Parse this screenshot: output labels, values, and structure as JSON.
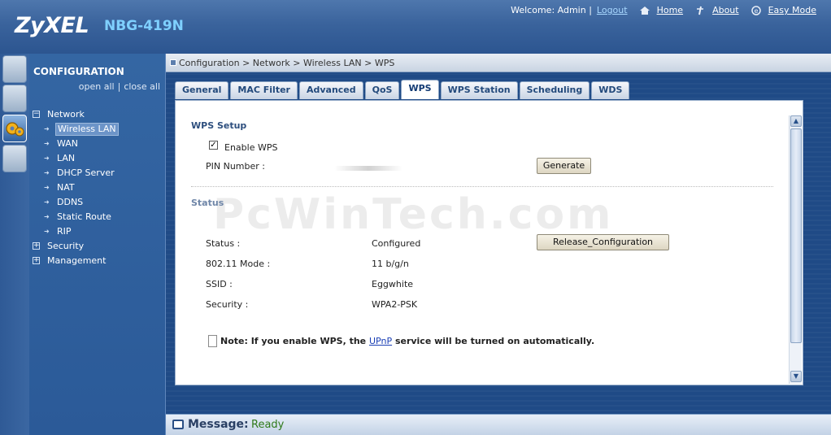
{
  "header": {
    "brand": "ZyXEL",
    "model": "NBG-419N",
    "welcome": "Welcome: Admin |",
    "logout": "Logout",
    "home": "Home",
    "about": "About",
    "easy_mode": "Easy Mode"
  },
  "nav": {
    "title": "CONFIGURATION",
    "open_all": "open all",
    "close_all": "close all",
    "network": "Network",
    "network_items": [
      "Wireless LAN",
      "WAN",
      "LAN",
      "DHCP Server",
      "NAT",
      "DDNS",
      "Static Route",
      "RIP"
    ],
    "security": "Security",
    "management": "Management"
  },
  "breadcrumb": "Configuration > Network > Wireless LAN > WPS",
  "tabs": [
    "General",
    "MAC Filter",
    "Advanced",
    "QoS",
    "WPS",
    "WPS Station",
    "Scheduling",
    "WDS"
  ],
  "active_tab": "WPS",
  "wps_setup": {
    "title": "WPS Setup",
    "enable_label": "Enable WPS",
    "enable_checked": true,
    "pin_label": "PIN Number :",
    "generate_button": "Generate"
  },
  "status": {
    "title": "Status",
    "status_label": "Status :",
    "status_value": "Configured",
    "release_button": "Release_Configuration",
    "mode_label": "802.11 Mode :",
    "mode_value": "11 b/g/n",
    "ssid_label": "SSID :",
    "ssid_value": "Eggwhite",
    "security_label": "Security :",
    "security_value": "WPA2-PSK"
  },
  "note": {
    "prefix": "Note: If you enable WPS, the",
    "link": "UPnP",
    "suffix": "service will be turned on automatically."
  },
  "watermark": "PcWinTech.com",
  "message": {
    "label": "Message:",
    "status": "Ready"
  },
  "colors": {
    "header_blue": "#3a639c",
    "nav_blue": "#2b5a98",
    "ready_green": "#2f7a1a"
  }
}
